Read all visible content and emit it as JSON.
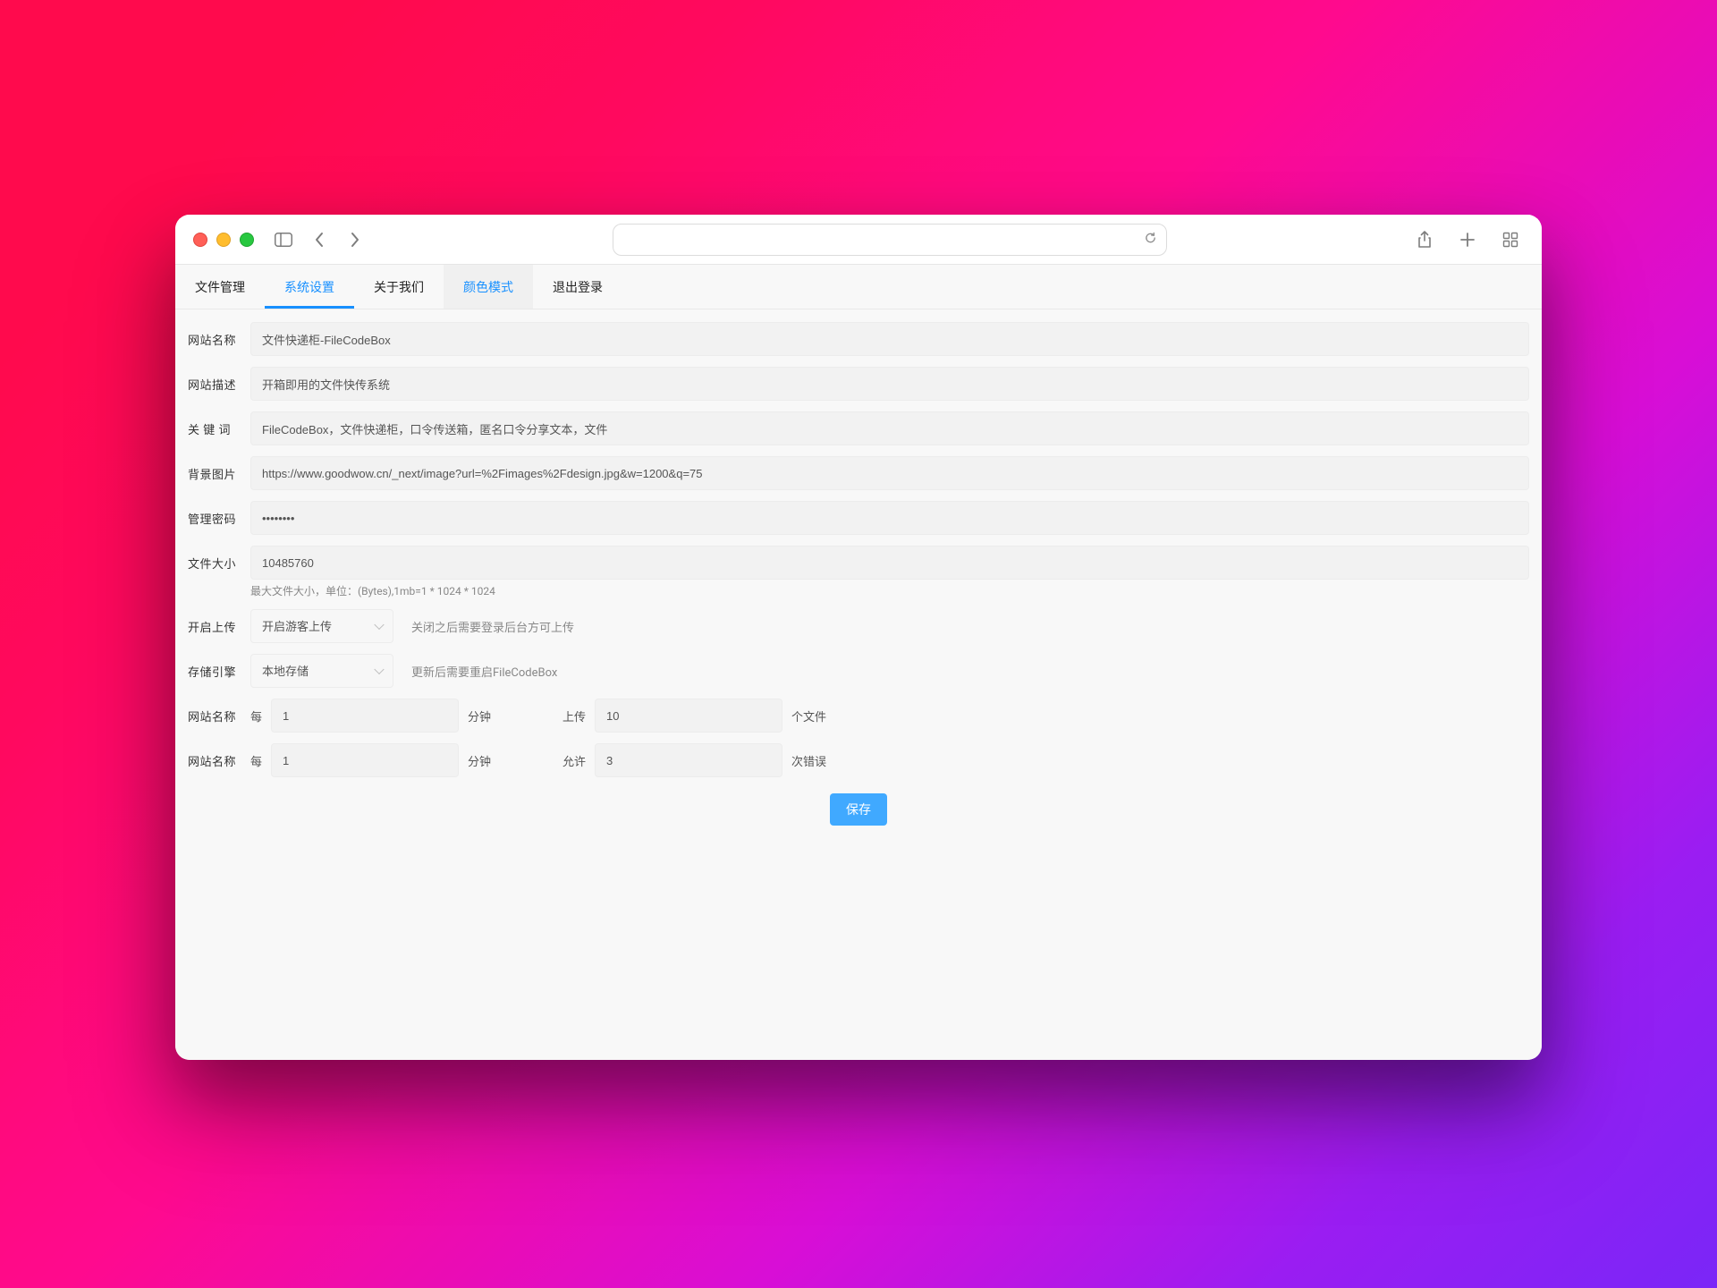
{
  "tabs": {
    "file_management": "文件管理",
    "system_settings": "系统设置",
    "about_us": "关于我们",
    "color_mode": "颜色模式",
    "logout": "退出登录"
  },
  "labels": {
    "site_name": "网站名称",
    "site_desc": "网站描述",
    "keywords": "关 键 词",
    "bg_image": "背景图片",
    "admin_password": "管理密码",
    "file_size": "文件大小",
    "enable_upload": "开启上传",
    "storage_engine": "存储引擎"
  },
  "values": {
    "site_name": "文件快递柜-FileCodeBox",
    "site_desc": "开箱即用的文件快传系统",
    "keywords": "FileCodeBox，文件快递柜，口令传送箱，匿名口令分享文本，文件",
    "bg_image": "https://www.goodwow.cn/_next/image?url=%2Fimages%2Fdesign.jpg&w=1200&q=75",
    "admin_password": "••••••••",
    "file_size": "10485760",
    "upload_option": "开启游客上传",
    "storage_option": "本地存储"
  },
  "help": {
    "file_size": "最大文件大小，单位：(Bytes),1mb=1 * 1024 * 1024",
    "upload_hint": "关闭之后需要登录后台方可上传",
    "storage_hint": "更新后需要重启FileCodeBox"
  },
  "rate": {
    "row_label": "网站名称",
    "every": "每",
    "minute": "分钟",
    "upload": "上传",
    "unit_files": "个文件",
    "allow": "允许",
    "unit_errors": "次错误",
    "r1_interval": "1",
    "r1_count": "10",
    "r2_interval": "1",
    "r2_count": "3"
  },
  "buttons": {
    "save": "保存"
  }
}
